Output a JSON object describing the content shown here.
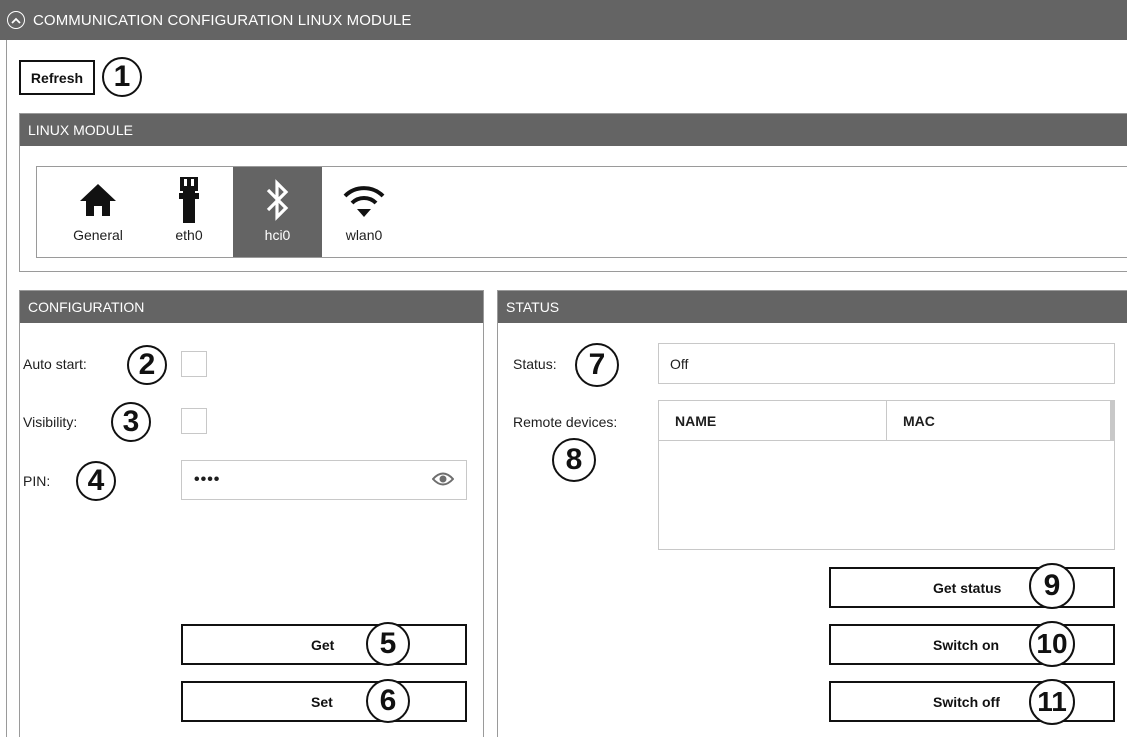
{
  "header": {
    "title": "COMMUNICATION CONFIGURATION LINUX MODULE",
    "collapse_icon": "chevron-up-circle-icon"
  },
  "toolbar": {
    "refresh_label": "Refresh"
  },
  "linux_module": {
    "title": "LINUX MODULE",
    "tabs": [
      {
        "label": "General",
        "icon": "home-icon",
        "active": false
      },
      {
        "label": "eth0",
        "icon": "ethernet-plug-icon",
        "active": false
      },
      {
        "label": "hci0",
        "icon": "bluetooth-icon",
        "active": true
      },
      {
        "label": "wlan0",
        "icon": "wifi-icon",
        "active": false
      }
    ]
  },
  "configuration": {
    "title": "CONFIGURATION",
    "auto_start_label": "Auto start:",
    "auto_start_checked": false,
    "visibility_label": "Visibility:",
    "visibility_checked": false,
    "pin_label": "PIN:",
    "pin_value": "••••",
    "pin_icon": "eye-icon",
    "get_label": "Get",
    "set_label": "Set"
  },
  "status": {
    "title": "STATUS",
    "status_label": "Status:",
    "status_value": "Off",
    "remote_devices_label": "Remote devices:",
    "columns": [
      "NAME",
      "MAC"
    ],
    "rows": [],
    "get_status_label": "Get status",
    "switch_on_label": "Switch on",
    "switch_off_label": "Switch off"
  },
  "callouts": [
    "1",
    "2",
    "3",
    "4",
    "5",
    "6",
    "7",
    "8",
    "9",
    "10",
    "11"
  ],
  "colors": {
    "header_bg": "#646464",
    "header_text": "#ffffff",
    "active_tab_bg": "#646464",
    "border": "#9a9a9a"
  }
}
